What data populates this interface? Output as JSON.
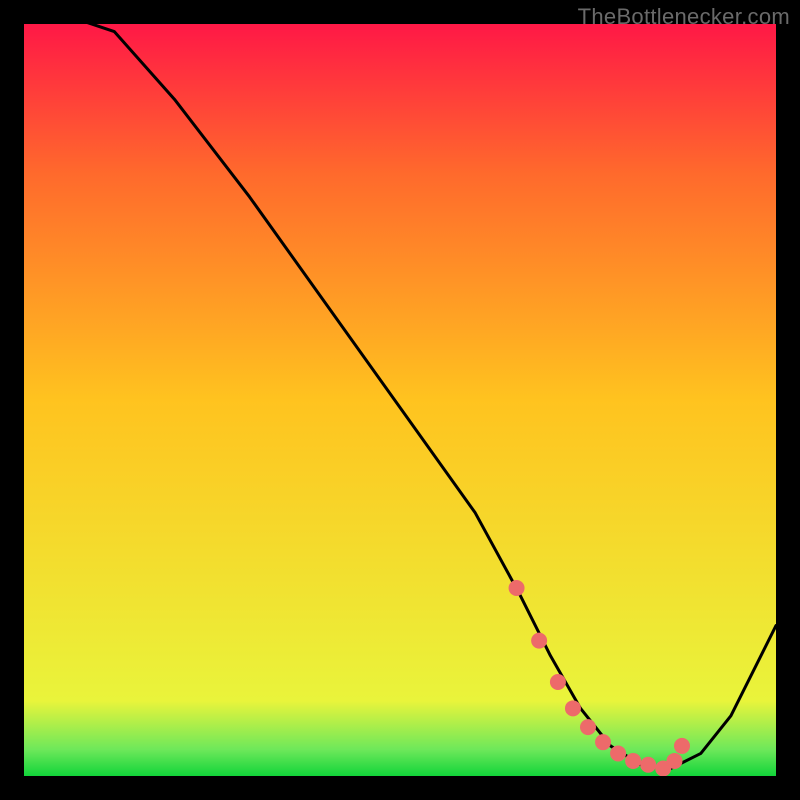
{
  "watermark": "TheBottlenecker.com",
  "chart_data": {
    "type": "line",
    "title": "",
    "xlabel": "",
    "ylabel": "",
    "xlim": [
      0,
      100
    ],
    "ylim": [
      0,
      100
    ],
    "series": [
      {
        "name": "curve",
        "x": [
          0,
          12,
          20,
          30,
          40,
          50,
          60,
          66,
          70,
          74,
          78,
          82,
          86,
          90,
          94,
          100
        ],
        "y": [
          103,
          99,
          90,
          77,
          63,
          49,
          35,
          24,
          16,
          9,
          4,
          1.5,
          1,
          3,
          8,
          20
        ]
      }
    ],
    "markers": {
      "name": "highlight-points",
      "x": [
        65.5,
        68.5,
        71,
        73,
        75,
        77,
        79,
        81,
        83,
        85,
        86.5,
        87.5
      ],
      "y": [
        25,
        18,
        12.5,
        9,
        6.5,
        4.5,
        3,
        2,
        1.5,
        1,
        2,
        4
      ]
    },
    "bands": [
      {
        "name": "green-band",
        "y0": 0,
        "y1": 3.5,
        "color0": "#12d43a",
        "color1": "#6de85a"
      },
      {
        "name": "lime-band",
        "y0": 3.5,
        "y1": 10,
        "color0": "#6de85a",
        "color1": "#e9f43b"
      },
      {
        "name": "yellow-band",
        "y0": 10,
        "y1": 50,
        "color0": "#e9f43b",
        "color1": "#ffc31f"
      },
      {
        "name": "orange-band",
        "y0": 50,
        "y1": 80,
        "color0": "#ffc31f",
        "color1": "#ff6a2c"
      },
      {
        "name": "red-band",
        "y0": 80,
        "y1": 100,
        "color0": "#ff6a2c",
        "color1": "#ff1846"
      }
    ]
  }
}
